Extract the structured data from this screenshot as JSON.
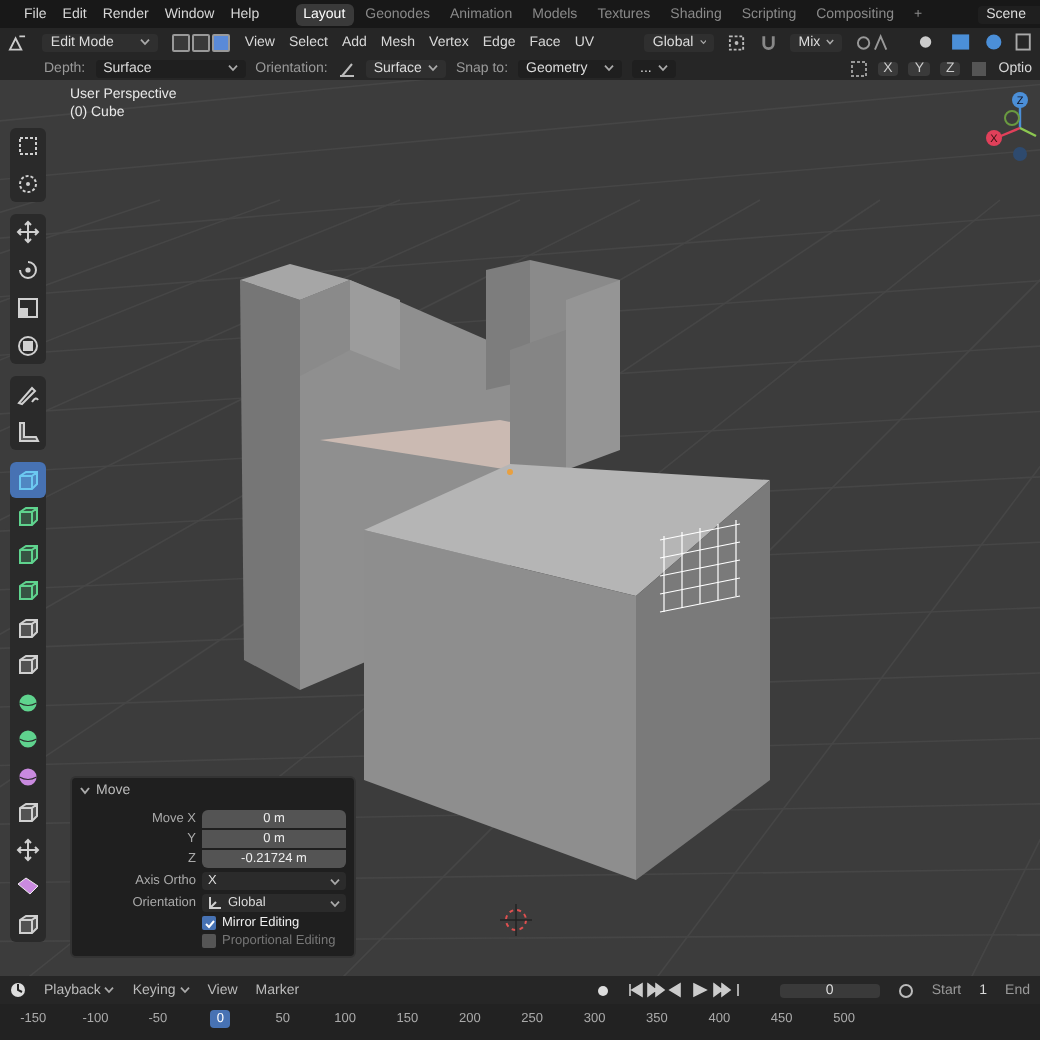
{
  "menu_bar": {
    "menus": [
      "File",
      "Edit",
      "Render",
      "Window",
      "Help"
    ],
    "workspaces": [
      {
        "label": "Layout",
        "selected": true
      },
      {
        "label": "Geonodes",
        "selected": false
      },
      {
        "label": "Animation",
        "selected": false
      },
      {
        "label": "Models",
        "selected": false
      },
      {
        "label": "Textures",
        "selected": false
      },
      {
        "label": "Shading",
        "selected": false
      },
      {
        "label": "Scripting",
        "selected": false
      },
      {
        "label": "Compositing",
        "selected": false
      }
    ],
    "add_workspace": "+",
    "scene": "Scene"
  },
  "header": {
    "mode": "Edit Mode",
    "select_modes": [
      {
        "selected": false
      },
      {
        "selected": false
      },
      {
        "selected": true
      }
    ],
    "menus": [
      "View",
      "Select",
      "Add",
      "Mesh",
      "Vertex",
      "Edge",
      "Face",
      "UV"
    ],
    "orientation": "Global",
    "pivot": "Mix"
  },
  "tool_settings": {
    "depth_label": "Depth:",
    "depth": "Surface",
    "orientation_label": "Orientation:",
    "orientation": "Surface",
    "snap_label": "Snap to:",
    "snap": "Geometry",
    "snap_more": "...",
    "axes": [
      "X",
      "Y",
      "Z"
    ],
    "options": "Optio"
  },
  "viewport": {
    "title": "User Perspective",
    "object": "(0) Cube",
    "gizmo": {
      "z": "Z",
      "x": "X"
    }
  },
  "toolbar": {
    "groups": [
      [
        {
          "kind": "select-box",
          "color": "#d0d0d0",
          "selected": false
        },
        {
          "kind": "cursor",
          "color": "#d0d0d0",
          "selected": false
        }
      ],
      [
        {
          "kind": "move",
          "color": "#d0d0d0",
          "selected": false
        },
        {
          "kind": "rotate",
          "color": "#d0d0d0",
          "selected": false
        },
        {
          "kind": "scale",
          "color": "#d0d0d0",
          "selected": false
        },
        {
          "kind": "transform",
          "color": "#d0d0d0",
          "selected": false
        }
      ],
      [
        {
          "kind": "pen",
          "color": "#d0d0d0",
          "selected": false
        },
        {
          "kind": "ruler",
          "color": "#d0d0d0",
          "selected": false
        }
      ],
      [
        {
          "kind": "cube",
          "color": "#6cc8f0",
          "selected": true
        },
        {
          "kind": "cube",
          "color": "#5fd38e",
          "selected": false
        },
        {
          "kind": "cube",
          "color": "#5fd38e",
          "selected": false
        },
        {
          "kind": "cube",
          "color": "#5fd38e",
          "selected": false
        },
        {
          "kind": "cube",
          "color": "#d0d0d0",
          "selected": false
        },
        {
          "kind": "cube",
          "color": "#d0d0d0",
          "selected": false
        },
        {
          "kind": "sphere",
          "color": "#5fd38e",
          "selected": false
        },
        {
          "kind": "sphere",
          "color": "#5fd38e",
          "selected": false
        },
        {
          "kind": "sphere",
          "color": "#c98adf",
          "selected": false
        },
        {
          "kind": "cube",
          "color": "#d0d0d0",
          "selected": false
        },
        {
          "kind": "move",
          "color": "#d0d0d0",
          "selected": false
        },
        {
          "kind": "slab",
          "color": "#c98adf",
          "selected": false
        },
        {
          "kind": "cube",
          "color": "#d0d0d0",
          "selected": false
        }
      ]
    ]
  },
  "operator_panel": {
    "title": "Move",
    "expanded": true,
    "fields": [
      {
        "label": "Move X",
        "value": "0 m"
      },
      {
        "label": "Y",
        "value": "0 m"
      },
      {
        "label": "Z",
        "value": "-0.21724 m"
      }
    ],
    "axis_ortho": {
      "label": "Axis Ortho",
      "value": "X"
    },
    "orientation": {
      "label": "Orientation",
      "value": "Global"
    },
    "options": [
      {
        "label": "Mirror Editing",
        "checked": true,
        "disabled": false
      },
      {
        "label": "Proportional Editing",
        "checked": false,
        "disabled": true
      }
    ]
  },
  "timeline": {
    "menus": [
      {
        "label": "Playback",
        "caret": true
      },
      {
        "label": "Keying",
        "caret": true
      },
      {
        "label": "View",
        "caret": false
      },
      {
        "label": "Marker",
        "caret": false
      }
    ],
    "current_frame": "0",
    "start_label": "Start",
    "start": "1",
    "end_label": "End",
    "ruler": [
      {
        "label": "-150",
        "selected": false
      },
      {
        "label": "-100",
        "selected": false
      },
      {
        "label": "-50",
        "selected": false
      },
      {
        "label": "0",
        "selected": true
      },
      {
        "label": "50",
        "selected": false
      },
      {
        "label": "100",
        "selected": false
      },
      {
        "label": "150",
        "selected": false
      },
      {
        "label": "200",
        "selected": false
      },
      {
        "label": "250",
        "selected": false
      },
      {
        "label": "300",
        "selected": false
      },
      {
        "label": "350",
        "selected": false
      },
      {
        "label": "400",
        "selected": false
      },
      {
        "label": "450",
        "selected": false
      },
      {
        "label": "500",
        "selected": false
      }
    ]
  }
}
